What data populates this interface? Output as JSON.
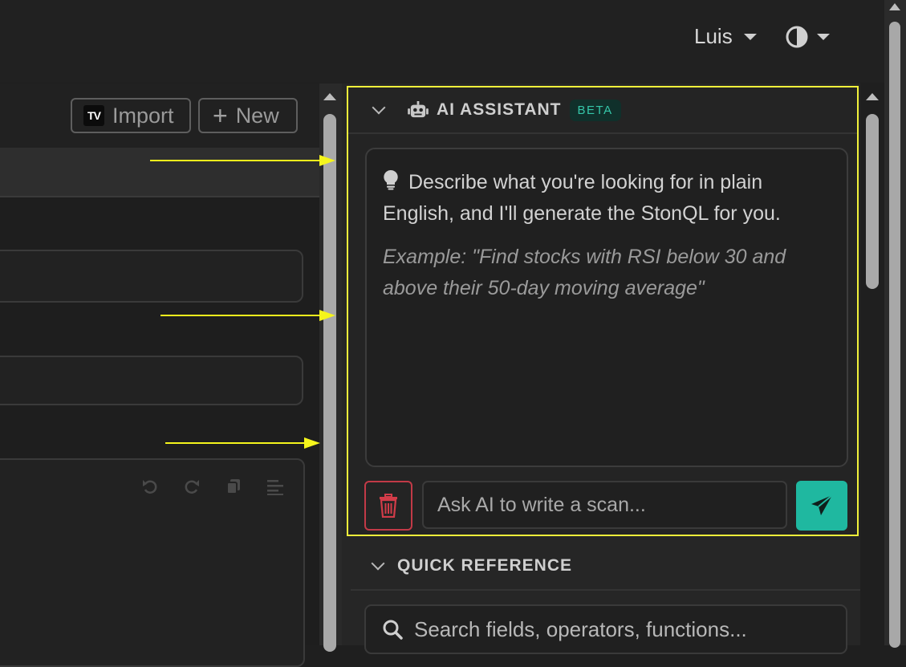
{
  "topbar": {
    "user_name": "Luis"
  },
  "editor": {
    "import_label": "Import",
    "new_label": "New",
    "import_logo_text": "TV"
  },
  "ai_assistant": {
    "title": "AI ASSISTANT",
    "badge": "BETA",
    "intro": "Describe what you're looking for in plain English, and I'll generate the StonQL for you.",
    "example": "Example: \"Find stocks with RSI below 30 and above their 50-day moving average\"",
    "input_placeholder": "Ask AI to write a scan..."
  },
  "quick_reference": {
    "title": "QUICK REFERENCE",
    "search_placeholder": "Search fields, operators, functions..."
  },
  "colors": {
    "accent": "#1fb8a0",
    "danger": "#c23a47",
    "highlight": "#f1f13a",
    "beta_text": "#35c6a9"
  },
  "icons": {
    "user_caret": "caret-down-icon",
    "theme": "contrast-icon",
    "import": "tradingview-logo-icon",
    "new": "plus-icon",
    "undo": "undo-icon",
    "redo": "redo-icon",
    "copy": "copy-icon",
    "format": "align-left-icon",
    "ai": "robot-icon",
    "tip": "lightbulb-icon",
    "clear": "trash-icon",
    "send": "paper-plane-icon",
    "search": "search-icon"
  }
}
